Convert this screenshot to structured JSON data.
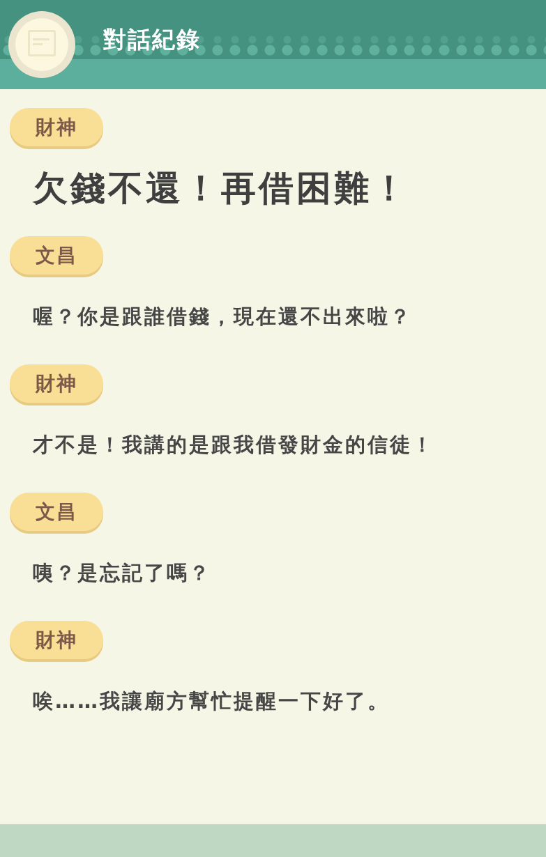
{
  "header": {
    "title": "對話紀錄"
  },
  "messages": [
    {
      "speaker": "財神",
      "text": "欠錢不還！再借困難！",
      "kind": "shout"
    },
    {
      "speaker": "文昌",
      "text": "喔？你是跟誰借錢，現在還不出來啦？",
      "kind": "normal"
    },
    {
      "speaker": "財神",
      "text": "才不是！我講的是跟我借發財金的信徒！",
      "kind": "normal"
    },
    {
      "speaker": "文昌",
      "text": "咦？是忘記了嗎？",
      "kind": "normal"
    },
    {
      "speaker": "財神",
      "text": "唉……我讓廟方幫忙提醒一下好了。",
      "kind": "normal"
    }
  ]
}
